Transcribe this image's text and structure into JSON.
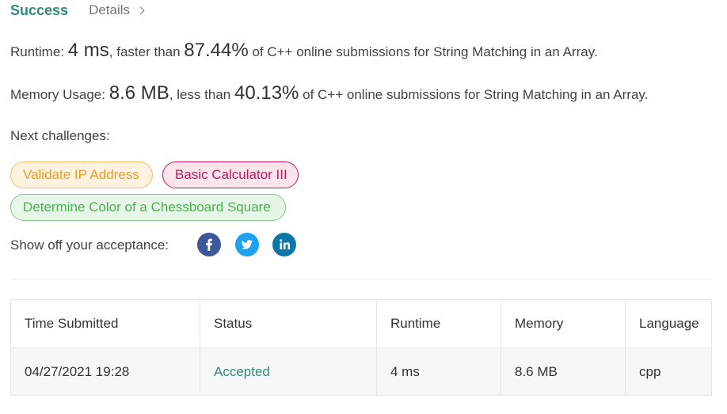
{
  "header": {
    "status": "Success",
    "details_label": "Details"
  },
  "runtime": {
    "label": "Runtime:",
    "value": "4 ms",
    "comparison": ", faster than",
    "percent": "87.44%",
    "suffix": "of C++ online submissions for String Matching in an Array."
  },
  "memory": {
    "label": "Memory Usage:",
    "value": "8.6 MB",
    "comparison": ", less than",
    "percent": "40.13%",
    "suffix": "of C++ online submissions for String Matching in an Array."
  },
  "next": {
    "label": "Next challenges:",
    "challenges": [
      {
        "title": "Validate IP Address",
        "color": "#ef9b20"
      },
      {
        "title": "Basic Calculator III",
        "color": "#c2185b"
      },
      {
        "title": "Determine Color of a Chessboard Square",
        "color": "#4caf50"
      }
    ]
  },
  "share": {
    "label": "Show off your acceptance:",
    "icons": [
      "facebook-icon",
      "twitter-icon",
      "linkedin-icon"
    ]
  },
  "submissions": {
    "columns": [
      "Time Submitted",
      "Status",
      "Runtime",
      "Memory",
      "Language"
    ],
    "rows": [
      {
        "time": "04/27/2021 19:28",
        "status": "Accepted",
        "runtime": "4 ms",
        "memory": "8.6 MB",
        "language": "cpp"
      }
    ]
  },
  "colors": {
    "accent": "#2e8b7c",
    "facebook": "#3b5998",
    "twitter": "#1da1f2",
    "linkedin": "#0e76a8"
  }
}
